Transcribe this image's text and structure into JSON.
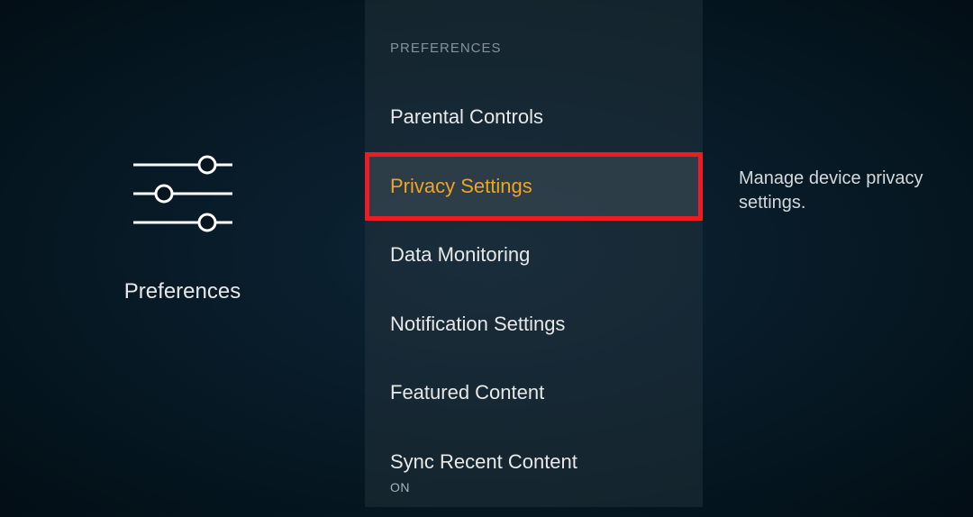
{
  "left": {
    "label": "Preferences"
  },
  "center": {
    "header": "PREFERENCES",
    "items": [
      {
        "label": "Parental Controls",
        "selected": false
      },
      {
        "label": "Privacy Settings",
        "selected": true
      },
      {
        "label": "Data Monitoring",
        "selected": false
      },
      {
        "label": "Notification Settings",
        "selected": false
      },
      {
        "label": "Featured Content",
        "selected": false
      },
      {
        "label": "Sync Recent Content",
        "selected": false,
        "sub": "ON"
      }
    ]
  },
  "right": {
    "description": "Manage device privacy settings."
  }
}
